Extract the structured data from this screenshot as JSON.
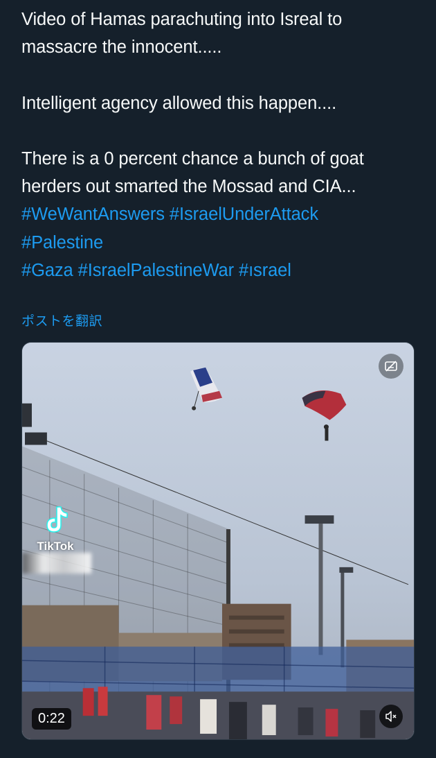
{
  "tweet": {
    "lines": [
      "Video of Hamas parachuting into Isreal to",
      "massacre the innocent.....",
      "Intelligent agency allowed this happen....",
      "There is a 0 percent chance a bunch of goat",
      "herders out smarted the Mossad and CIA..."
    ],
    "hashtags": {
      "row1": [
        "#WeWantAnswers",
        "#IsraelUnderAttack"
      ],
      "row2": [
        "#Palestine"
      ],
      "row3": [
        "#Gaza",
        "#IsraelPalestineWar",
        "#ısrael"
      ]
    },
    "translate_label": "ポストを翻訳"
  },
  "media": {
    "watermark": "TikTok",
    "duration": "0:22",
    "mute_icon": "speaker-muted-icon",
    "sensitive_icon": "image-settings-icon"
  },
  "colors": {
    "background": "#15202b",
    "text": "#f7f9f9",
    "link": "#1d9bf0"
  }
}
